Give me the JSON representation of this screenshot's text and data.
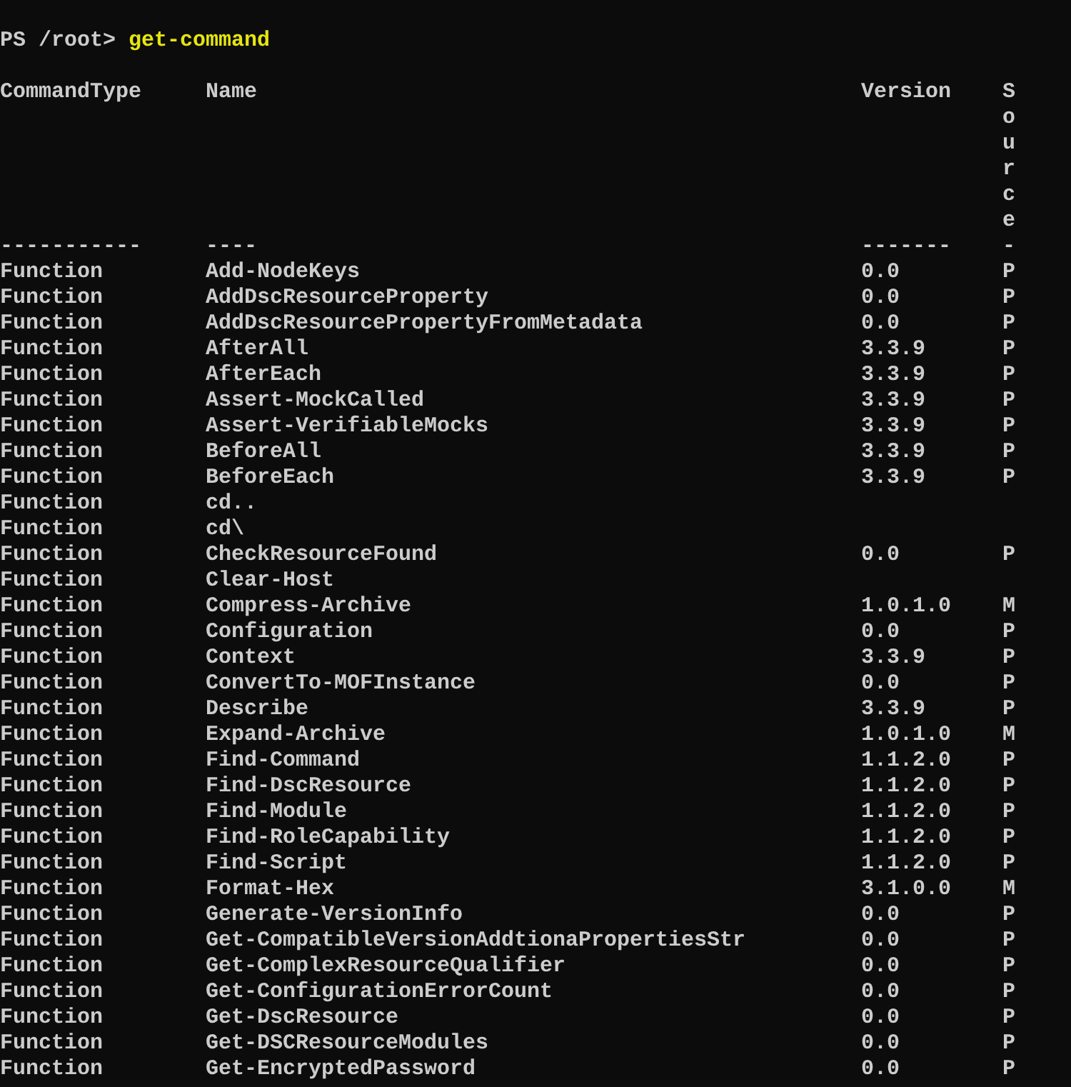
{
  "prompt": {
    "text": "PS /root> ",
    "command": "get-command"
  },
  "table": {
    "columns": [
      {
        "label": "CommandType",
        "rule": "-----------"
      },
      {
        "label": "Name",
        "rule": "----"
      },
      {
        "label": "Version",
        "rule": "-------"
      },
      {
        "label": "Source",
        "rule": "-"
      }
    ],
    "rows": [
      {
        "type": "Function",
        "name": "Add-NodeKeys",
        "version": "0.0",
        "source": "P"
      },
      {
        "type": "Function",
        "name": "AddDscResourceProperty",
        "version": "0.0",
        "source": "P"
      },
      {
        "type": "Function",
        "name": "AddDscResourcePropertyFromMetadata",
        "version": "0.0",
        "source": "P"
      },
      {
        "type": "Function",
        "name": "AfterAll",
        "version": "3.3.9",
        "source": "P"
      },
      {
        "type": "Function",
        "name": "AfterEach",
        "version": "3.3.9",
        "source": "P"
      },
      {
        "type": "Function",
        "name": "Assert-MockCalled",
        "version": "3.3.9",
        "source": "P"
      },
      {
        "type": "Function",
        "name": "Assert-VerifiableMocks",
        "version": "3.3.9",
        "source": "P"
      },
      {
        "type": "Function",
        "name": "BeforeAll",
        "version": "3.3.9",
        "source": "P"
      },
      {
        "type": "Function",
        "name": "BeforeEach",
        "version": "3.3.9",
        "source": "P"
      },
      {
        "type": "Function",
        "name": "cd.."
      },
      {
        "type": "Function",
        "name": "cd\\"
      },
      {
        "type": "Function",
        "name": "CheckResourceFound",
        "version": "0.0",
        "source": "P"
      },
      {
        "type": "Function",
        "name": "Clear-Host"
      },
      {
        "type": "Function",
        "name": "Compress-Archive",
        "version": "1.0.1.0",
        "source": "M"
      },
      {
        "type": "Function",
        "name": "Configuration",
        "version": "0.0",
        "source": "P"
      },
      {
        "type": "Function",
        "name": "Context",
        "version": "3.3.9",
        "source": "P"
      },
      {
        "type": "Function",
        "name": "ConvertTo-MOFInstance",
        "version": "0.0",
        "source": "P"
      },
      {
        "type": "Function",
        "name": "Describe",
        "version": "3.3.9",
        "source": "P"
      },
      {
        "type": "Function",
        "name": "Expand-Archive",
        "version": "1.0.1.0",
        "source": "M"
      },
      {
        "type": "Function",
        "name": "Find-Command",
        "version": "1.1.2.0",
        "source": "P"
      },
      {
        "type": "Function",
        "name": "Find-DscResource",
        "version": "1.1.2.0",
        "source": "P"
      },
      {
        "type": "Function",
        "name": "Find-Module",
        "version": "1.1.2.0",
        "source": "P"
      },
      {
        "type": "Function",
        "name": "Find-RoleCapability",
        "version": "1.1.2.0",
        "source": "P"
      },
      {
        "type": "Function",
        "name": "Find-Script",
        "version": "1.1.2.0",
        "source": "P"
      },
      {
        "type": "Function",
        "name": "Format-Hex",
        "version": "3.1.0.0",
        "source": "M"
      },
      {
        "type": "Function",
        "name": "Generate-VersionInfo",
        "version": "0.0",
        "source": "P"
      },
      {
        "type": "Function",
        "name": "Get-CompatibleVersionAddtionaPropertiesStr",
        "version": "0.0",
        "source": "P"
      },
      {
        "type": "Function",
        "name": "Get-ComplexResourceQualifier",
        "version": "0.0",
        "source": "P"
      },
      {
        "type": "Function",
        "name": "Get-ConfigurationErrorCount",
        "version": "0.0",
        "source": "P"
      },
      {
        "type": "Function",
        "name": "Get-DscResource",
        "version": "0.0",
        "source": "P"
      },
      {
        "type": "Function",
        "name": "Get-DSCResourceModules",
        "version": "0.0",
        "source": "P"
      },
      {
        "type": "Function",
        "name": "Get-EncryptedPassword",
        "version": "0.0",
        "source": "P"
      }
    ]
  }
}
